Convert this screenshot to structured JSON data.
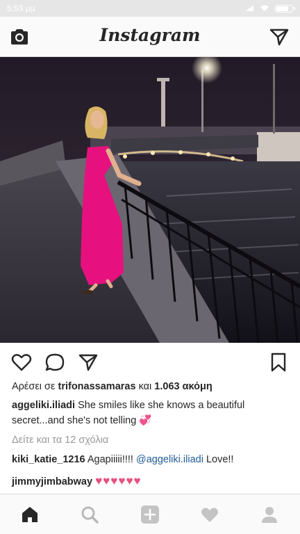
{
  "status_bar": {
    "time": "5:53 μμ"
  },
  "header": {
    "app_title": "Instagram"
  },
  "post": {
    "likes_prefix": "Αρέσει σε",
    "liked_by_user": "trifonassamaras",
    "likes_connector": "και",
    "likes_count": "1.063 ακόμη",
    "author": "aggeliki.iliadi",
    "caption_text": "She smiles like she knows a beautiful secret...and she's not telling",
    "caption_emoji": "💞",
    "view_comments": "Δείτε και τα 12 σχόλια",
    "comments": [
      {
        "user": "kiki_katie_1216",
        "text": "Agapiiiii!!!!",
        "mention": "@aggeliki.iliadi",
        "text_after": "Love!!"
      },
      {
        "user": "jimmyjimbabway",
        "text": "♥♥♥♥♥♥"
      }
    ]
  },
  "icons": {
    "header": [
      "camera-icon",
      "direct-message-icon"
    ],
    "actions": [
      "heart-icon",
      "comment-icon",
      "share-icon",
      "bookmark-icon"
    ],
    "bottom_nav": [
      "home-icon",
      "search-icon",
      "add-post-icon",
      "activity-heart-icon",
      "profile-icon"
    ]
  },
  "colors": {
    "heart_pink": "#e8507e",
    "mention_blue": "#1f5b96",
    "muted": "#999999"
  }
}
